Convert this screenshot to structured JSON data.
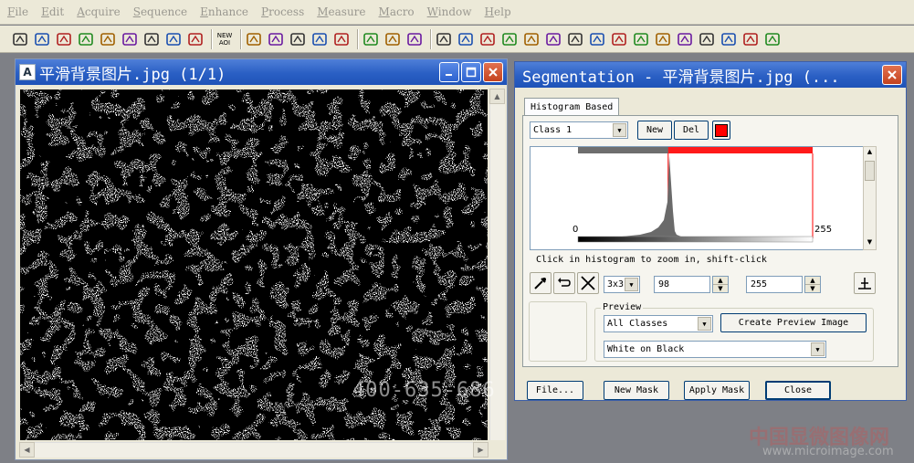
{
  "menubar": {
    "items": [
      "File",
      "Edit",
      "Acquire",
      "Sequence",
      "Enhance",
      "Process",
      "Measure",
      "Macro",
      "Window",
      "Help"
    ]
  },
  "toolbar": {
    "icons": [
      "open-folder-icon",
      "save-icon",
      "grid-icon",
      "camera-icon",
      "lasso-icon",
      "print-icon",
      "book-icon",
      "envelope-icon",
      "undo-icon",
      "new-aoi-icon",
      "rectangle-icon",
      "ellipse-icon",
      "polygon-icon",
      "polyline-icon",
      "pencil-icon",
      "zoom-icon",
      "hand-icon",
      "zoom-window-icon",
      "calibrate-icon",
      "histogram-icon",
      "line-profile-icon",
      "stack-icon",
      "grid-image-icon",
      "threshold-icon",
      "count-icon",
      "color-bars-icon",
      "measure-icon",
      "film-icon",
      "text-a-icon",
      "snapshot-icon",
      "spectrum-icon",
      "spectrum-2-icon",
      "cube-icon",
      "crop-icon"
    ],
    "new_aoi_label": "NEW AOI"
  },
  "image_window": {
    "title": "平滑背景图片.jpg  (1/1)"
  },
  "segmentation": {
    "title": "Segmentation - 平滑背景图片.jpg (...",
    "tab": "Histogram Based",
    "class_value": "Class 1",
    "new_label": "New",
    "del_label": "Del",
    "class_color": "#ff0000",
    "hist_min_label": "0",
    "hist_max_label": "255",
    "hist_hint": "Click in histogram to zoom in, shift-click",
    "kernel_value": "3x3",
    "low_value": "98",
    "high_value": "255",
    "preview_label": "Preview",
    "preview_classes": "All Classes",
    "create_preview_label": "Create Preview Image",
    "preview_mode": "White on Black",
    "file_label": "File...",
    "new_mask_label": "New Mask",
    "apply_mask_label": "Apply Mask",
    "close_label": "Close"
  },
  "watermark": {
    "phone": "400-635-686",
    "cn_name": "中国显微图像网",
    "site": "www.microimage.com"
  }
}
